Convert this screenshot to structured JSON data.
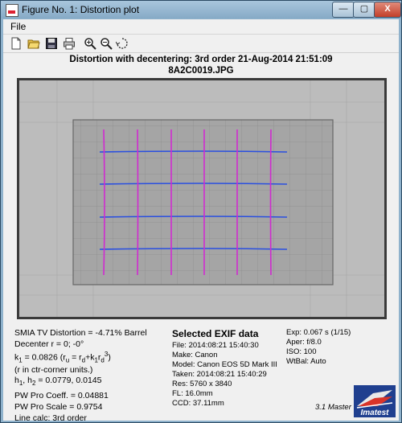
{
  "window": {
    "title": "Figure No. 1: Distortion plot",
    "min": "—",
    "max": "▢",
    "close": "X"
  },
  "menu": {
    "file": "File"
  },
  "toolbar": {
    "icons": [
      "new-icon",
      "open-icon",
      "save-icon",
      "print-icon",
      "zoom-in-icon",
      "zoom-out-icon",
      "rotate-icon"
    ]
  },
  "header": {
    "line1": "Distortion with decentering:  3rd order      21-Aug-2014 21:51:09",
    "line2": "8A2C0019.JPG"
  },
  "results": {
    "smia": "SMIA TV Distortion = -4.71% Barrel",
    "decenter": "Decenter r = 0;  -0°",
    "k1": "k",
    "k1_sub": "1",
    "k1_val": " = 0.0826  (r",
    "ru_sub": "u",
    "ru_eq": " = r",
    "rd_sub": "d",
    "rd_plus": "+k",
    "k1b_sub": "1",
    "rd3": "r",
    "rd3_sub": "d",
    "rd3_sup": "3",
    "rd3_close": ")",
    "ctr": "(r in ctr-corner units.)",
    "h": "h",
    "h1": "1",
    "hcomma": ", h",
    "h2": "2",
    "hval": " = 0.0779, 0.0145",
    "pw_coeff": "PW Pro Coeff. = 0.04881",
    "pw_scale": "PW Pro Scale = 0.9754",
    "line_calc": "Line calc: 3rd order"
  },
  "exif": {
    "heading": "Selected EXIF data",
    "file": "File:  2014:08:21 15:40:30",
    "make": "Make:  Canon",
    "model": "Model: Canon EOS 5D Mark III",
    "taken": "Taken: 2014:08:21 15:40:29",
    "res": "Res:    5760 x 3840",
    "fl": "FL:  16.0mm",
    "ccd": "CCD:   37.11mm"
  },
  "exposure": {
    "exp": "Exp:   0.067 s  (1/15)",
    "aper": "Aper:  f/8.0",
    "iso": "ISO:    100",
    "wtbal": "WtBal:  Auto"
  },
  "version": "3.1  Master",
  "logo_text": "Imatest",
  "colors": {
    "horizontal_lines": "#2a4fe0",
    "vertical_lines": "#d02ad0",
    "accent": "#e03020"
  }
}
